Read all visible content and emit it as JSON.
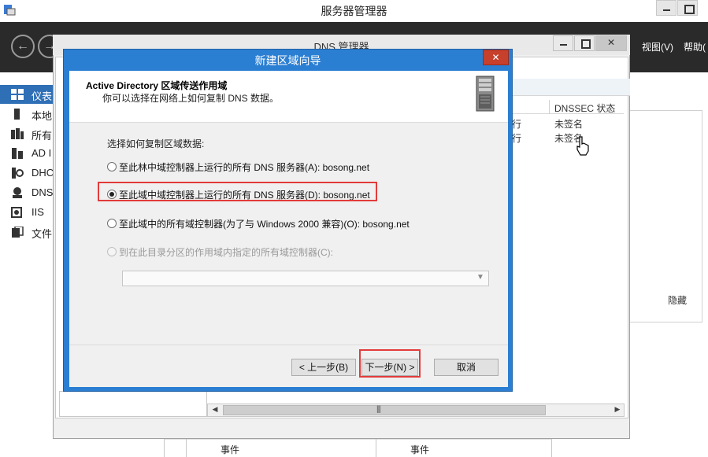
{
  "server_manager": {
    "title": "服务器管理器",
    "menu": {
      "view": "视图(V)",
      "help": "帮助("
    },
    "sidebar": [
      {
        "label": "仪表",
        "icon": "dashboard-icon"
      },
      {
        "label": "本地",
        "icon": "server-icon"
      },
      {
        "label": "所有",
        "icon": "servers-icon"
      },
      {
        "label": "AD I",
        "icon": "ad-icon"
      },
      {
        "label": "DHC",
        "icon": "dhcp-icon"
      },
      {
        "label": "DNS",
        "icon": "dns-icon"
      },
      {
        "label": "IIS",
        "icon": "iis-icon"
      },
      {
        "label": "文件",
        "icon": "file-icon"
      }
    ],
    "events": [
      "事件",
      "事件"
    ],
    "right_panel": {
      "hide": "隐藏"
    }
  },
  "dns_manager": {
    "title": "DNS 管理器",
    "columns": {
      "dnssec": "DNSSEC 状态"
    },
    "rows": [
      {
        "status": "行",
        "dnssec": "未签名"
      },
      {
        "status": "行",
        "dnssec": "未签名"
      }
    ]
  },
  "wizard": {
    "title": "新建区域向导",
    "heading": "Active Directory 区域传送作用域",
    "subheading": "你可以选择在网络上如何复制 DNS 数据。",
    "prompt": "选择如何复制区域数据:",
    "options": [
      {
        "label": "至此林中域控制器上运行的所有 DNS 服务器(A): bosong.net",
        "checked": false,
        "enabled": true
      },
      {
        "label": "至此域中域控制器上运行的所有 DNS 服务器(D): bosong.net",
        "checked": true,
        "enabled": true
      },
      {
        "label": "至此域中的所有域控制器(为了与 Windows 2000 兼容)(O): bosong.net",
        "checked": false,
        "enabled": true
      },
      {
        "label": "到在此目录分区的作用域内指定的所有域控制器(C):",
        "checked": false,
        "enabled": false
      }
    ],
    "partition_value": "",
    "buttons": {
      "back": "< 上一步(B)",
      "next": "下一步(N) >",
      "cancel": "取消"
    },
    "highlight_color": "#e23b3b",
    "title_bar_color": "#2b7fd3"
  }
}
